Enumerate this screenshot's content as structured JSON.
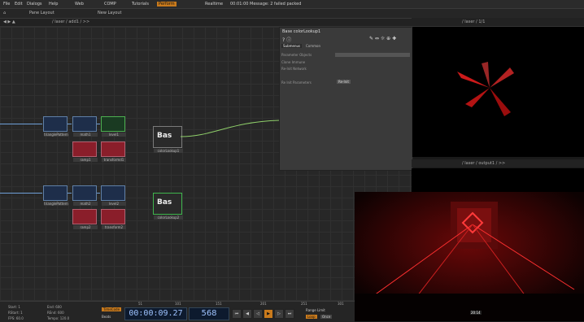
{
  "menubar": {
    "items": [
      "File",
      "Edit",
      "Dialogs",
      "Help"
    ],
    "pane_labels": [
      "Web",
      "COMP",
      "Tutorials"
    ],
    "perform": "Perform",
    "realtime": "Realtime",
    "message": "00:01:00 Message: 2 failed packed"
  },
  "toolbar": {
    "pane_layout": "Pane Layout",
    "new_layout": "New Layout"
  },
  "network_path": "/ laser / add1 / >>",
  "viewer_path": "/ laser / 1/1",
  "viewer2_path": "/ laser / output1 / >>",
  "params": {
    "title": "Base  colorLookup1",
    "tabs": [
      "Submenus",
      "Common"
    ],
    "rows": [
      "Parameter Objects",
      "Clone Immune",
      "Re-Init Network",
      "Re Init Parameters"
    ],
    "button": "Re-Init"
  },
  "nodes": [
    {
      "name": "trianglePattern1"
    },
    {
      "name": "math1"
    },
    {
      "name": "level1"
    },
    {
      "name": "ramp1"
    },
    {
      "name": "transformd1"
    },
    {
      "name": "colorLookup1"
    },
    {
      "name": "trianglePattern2"
    },
    {
      "name": "math2"
    },
    {
      "name": "level2"
    },
    {
      "name": "ramp2"
    },
    {
      "name": "transform2"
    },
    {
      "name": "colorLookup2"
    }
  ],
  "bas_label": "Bas",
  "timeline": {
    "timecode": "00:00:09.27",
    "frame": "568",
    "timecode_button": "TimeCode",
    "beats": "Beats",
    "range": "Range Limit",
    "loop": "Loop",
    "once": "Once",
    "stats": [
      "Start: 1",
      "End: 600",
      "RStart: 1",
      "REnd: 600",
      "FPS: 60.0",
      "Tempo: 120.0"
    ],
    "ruler": [
      "51",
      "101",
      "151",
      "201",
      "251",
      "301"
    ]
  },
  "cam_overlay": "20:14"
}
